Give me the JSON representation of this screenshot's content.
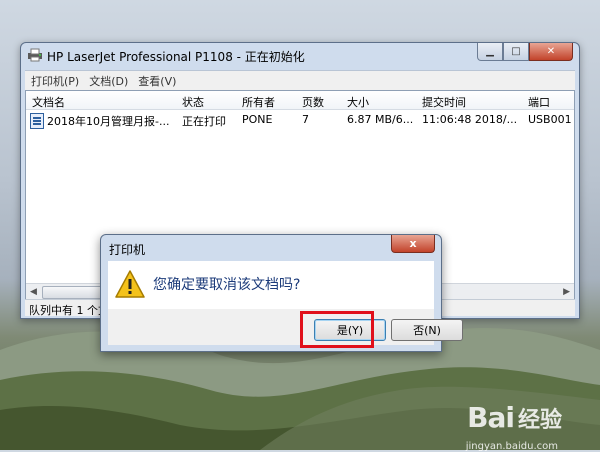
{
  "window": {
    "title": "HP LaserJet Professional P1108 - 正在初始化",
    "menus": [
      "打印机(P)",
      "文档(D)",
      "查看(V)"
    ],
    "columns": [
      "文档名",
      "状态",
      "所有者",
      "页数",
      "大小",
      "提交时间",
      "端口"
    ],
    "rows": [
      {
        "name": "2018年10月管理月报-...",
        "status": "正在打印",
        "owner": "PONE",
        "pages": "7",
        "size": "6.87 MB/6...",
        "submitted": "11:06:48   2018/...",
        "port": "USB001"
      }
    ],
    "status_text": "队列中有 1 个文"
  },
  "dialog": {
    "title": "打印机",
    "close_glyph": "x",
    "message": "您确定要取消该文档吗?",
    "yes_label": "是(Y)",
    "no_label": "否(N)"
  },
  "watermark": {
    "logo": "Bai",
    "logo2": "经验",
    "url": "jingyan.baidu.com"
  },
  "colors": {
    "highlight": "#e0101b",
    "message_text": "#1c3b7a"
  }
}
